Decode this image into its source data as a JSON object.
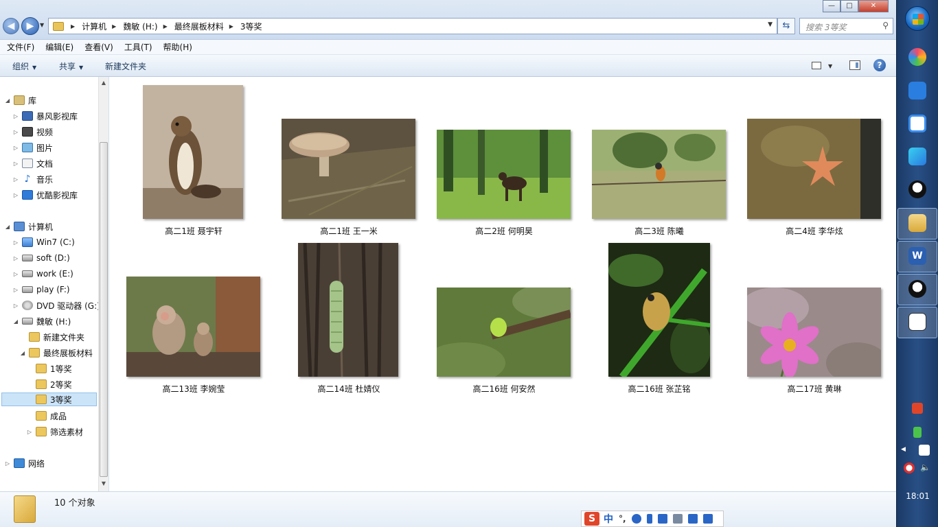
{
  "address": {
    "crumbs": [
      "计算机",
      "魏敏 (H:)",
      "最终展板材料",
      "3等奖"
    ]
  },
  "search": {
    "placeholder": "搜索 3等奖"
  },
  "window_controls": {
    "minimize": "—",
    "maximize": "□",
    "close": "✕"
  },
  "menu": [
    "文件(F)",
    "编辑(E)",
    "查看(V)",
    "工具(T)",
    "帮助(H)"
  ],
  "commands": {
    "organize": "组织",
    "share": "共享",
    "new_folder": "新建文件夹",
    "help": "?"
  },
  "nav": {
    "libraries": "库",
    "lib_items": [
      "暴风影视库",
      "视频",
      "图片",
      "文档",
      "音乐",
      "优酷影视库"
    ],
    "computer": "计算机",
    "drives": [
      "Win7 (C:)",
      "soft (D:)",
      "work (E:)",
      "play (F:)",
      "DVD 驱动器 (G:)",
      "魏敏 (H:)"
    ],
    "h_children": [
      "新建文件夹",
      "最终展板材料"
    ],
    "final_children": [
      "1等奖",
      "2等奖",
      "3等奖",
      "成品",
      "筛选素材"
    ],
    "network": "网络",
    "selected": "3等奖"
  },
  "files": [
    {
      "name": "高二1班 聂宇轩",
      "subject": "squirrel"
    },
    {
      "name": "高二1班 王一米",
      "subject": "mushroom"
    },
    {
      "name": "高二2班 何明昊",
      "subject": "deer"
    },
    {
      "name": "高二3班  陈曦",
      "subject": "bird"
    },
    {
      "name": "高二4班 李华炫",
      "subject": "starfish"
    },
    {
      "name": "高二13班 李婉莹",
      "subject": "monkeys"
    },
    {
      "name": "高二14班 杜婧仪",
      "subject": "caterpillar"
    },
    {
      "name": "高二16班 何安然",
      "subject": "green-larva"
    },
    {
      "name": "高二16班 张芷铭",
      "subject": "frog"
    },
    {
      "name": "高二17班 黄琳",
      "subject": "cosmos-flower"
    }
  ],
  "status": {
    "count": "10 个对象"
  },
  "ime": {
    "mode": "中",
    "punct": "°,"
  },
  "clock": {
    "time": "18:01"
  },
  "colors": {
    "accent": "#2b5fb0",
    "selection": "#cce4f7",
    "taskbar": "#284f85"
  }
}
